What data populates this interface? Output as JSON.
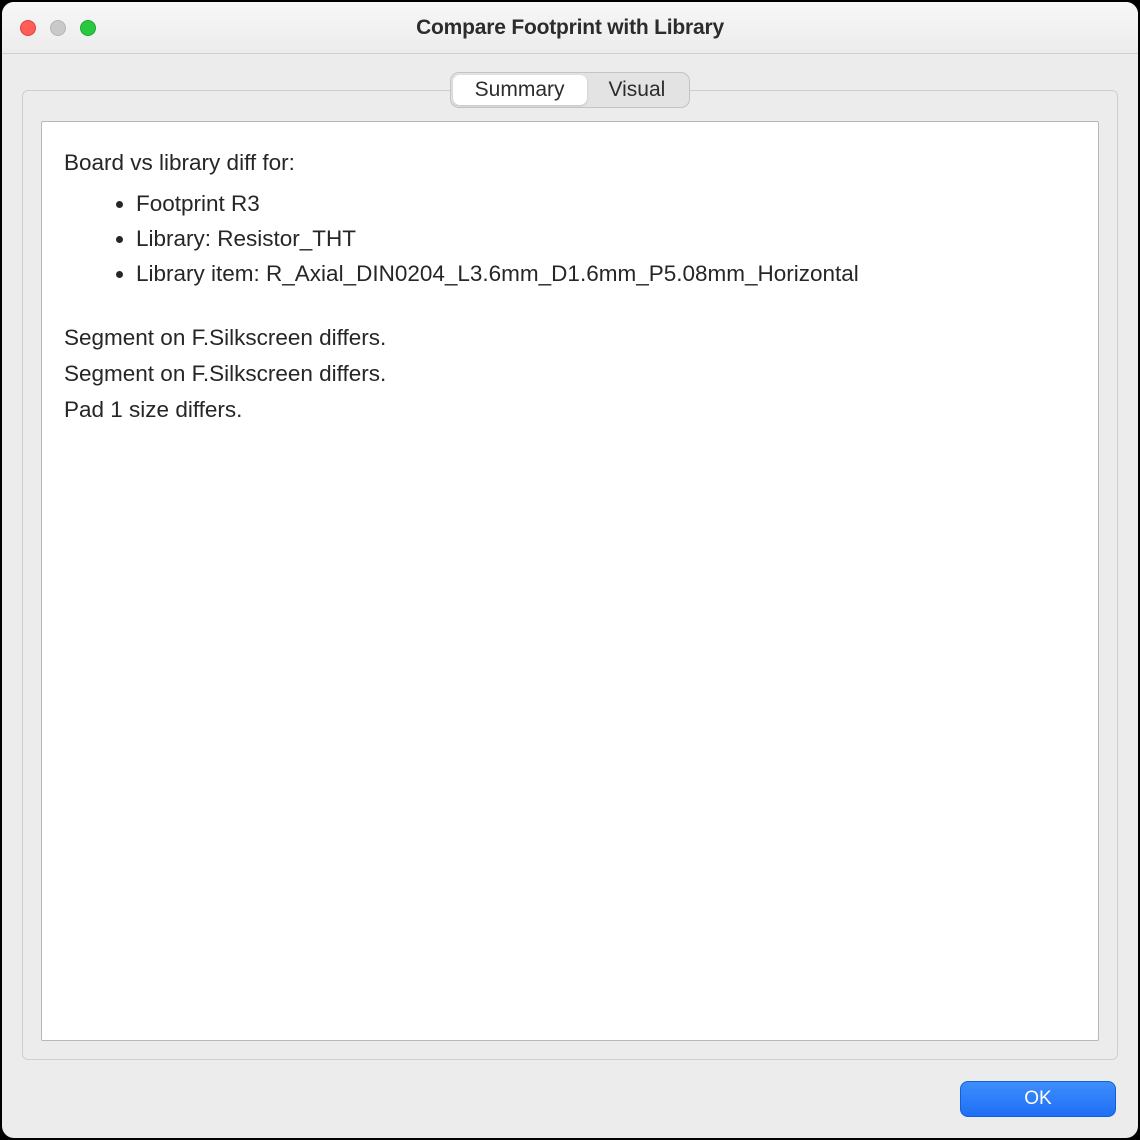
{
  "titlebar": {
    "title": "Compare Footprint with Library"
  },
  "tabs": {
    "items": [
      {
        "label": "Summary",
        "active": true
      },
      {
        "label": "Visual",
        "active": false
      }
    ]
  },
  "summary": {
    "heading": "Board vs library diff for:",
    "bullets": [
      "Footprint R3",
      "Library: Resistor_THT",
      "Library item: R_Axial_DIN0204_L3.6mm_D1.6mm_P5.08mm_Horizontal"
    ],
    "diffs": [
      "Segment on F.Silkscreen differs.",
      "Segment on F.Silkscreen differs.",
      "Pad 1 size differs."
    ]
  },
  "footer": {
    "ok_label": "OK"
  }
}
